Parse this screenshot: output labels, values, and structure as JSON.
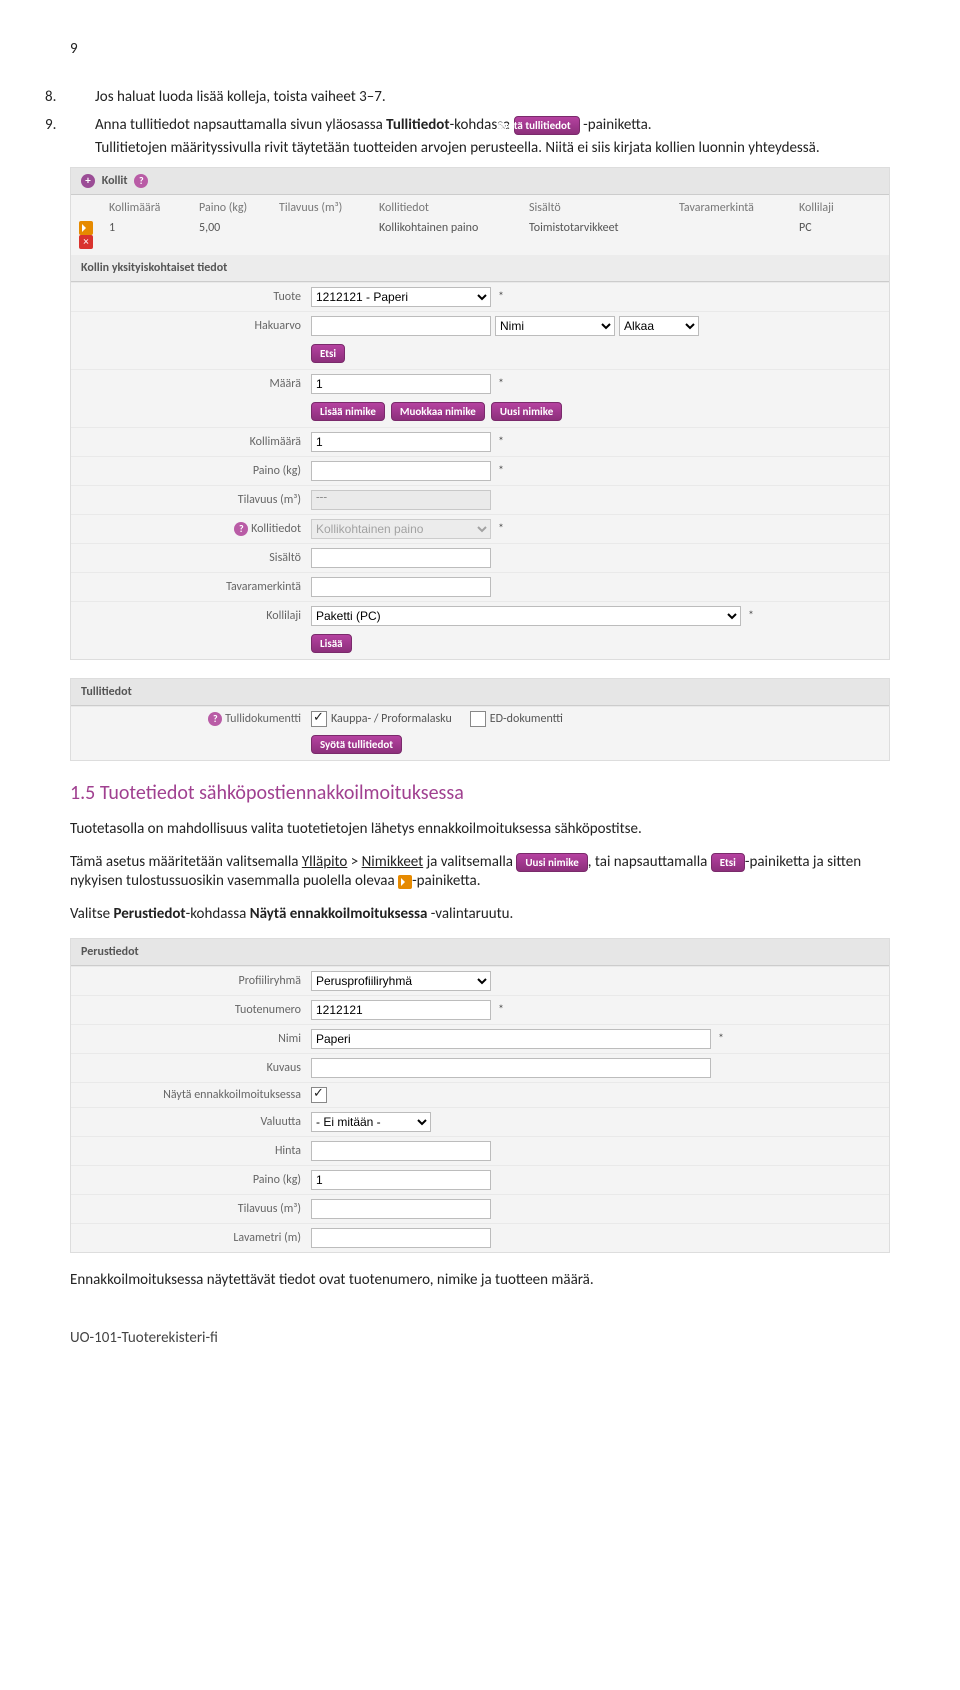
{
  "page_number": "9",
  "list8": {
    "num": "8.",
    "text": "Jos haluat luoda lisää kolleja, toista vaiheet 3–7."
  },
  "list9": {
    "num": "9.",
    "t1": "Anna tullitiedot napsauttamalla sivun yläosassa ",
    "t2": "Tullitiedot",
    "t3": "-kohdassa ",
    "btn": "Syötä tullitiedot",
    "t4": " -painiketta.",
    "t5": "Tullitietojen määrityssivulla rivit täytetään tuotteiden arvojen perusteella. Niitä ei siis kirjata kollien luonnin yhteydessä."
  },
  "kollit_section": {
    "title": "Kollit",
    "headers": [
      "Kollimäärä",
      "Paino (kg)",
      "Tilavuus (m³)",
      "Kollitiedot",
      "Sisältö",
      "Tavaramerkintä",
      "Kollilaji"
    ],
    "row": [
      "1",
      "5,00",
      "",
      "Kollikohtainen paino",
      "Toimistotarvikkeet",
      "",
      "PC"
    ],
    "subheader": "Kollin yksityiskohtaiset tiedot",
    "labels": {
      "tuote": "Tuote",
      "hakuarvo": "Hakuarvo",
      "maara": "Määrä",
      "kollimaara": "Kollimäärä",
      "paino": "Paino (kg)",
      "tilavuus": "Tilavuus (m³)",
      "kollitiedot": "Kollitiedot",
      "sisalto": "Sisältö",
      "tavaramerkinta": "Tavaramerkintä",
      "kollilaji": "Kollilaji"
    },
    "values": {
      "tuote": "1212121 - Paperi",
      "maara": "1",
      "kollimaara": "1",
      "tilavuus": "---",
      "kollitiedot": "Kollikohtainen paino",
      "kollilaji": "Paketti (PC)"
    },
    "hakuarvo_opts": {
      "nimi": "Nimi",
      "alkaa": "Alkaa"
    },
    "buttons": {
      "etsi": "Etsi",
      "lisaa_nimike": "Lisää nimike",
      "muokkaa_nimike": "Muokkaa nimike",
      "uusi_nimike": "Uusi nimike",
      "lisaa": "Lisää"
    }
  },
  "tullitiedot_section": {
    "title": "Tullitiedot",
    "label": "Tullidokumentti",
    "opt1": "Kauppa- / Proformalasku",
    "opt2": "ED-dokumentti",
    "btn": "Syötä tullitiedot"
  },
  "heading_1_5": "1.5  Tuotetiedot sähköpostiennakkoilmoituksessa",
  "para1": "Tuotetasolla on mahdollisuus valita tuotetietojen lähetys ennakkoilmoituksessa sähköpostitse.",
  "para2": {
    "t1": "Tämä asetus määritetään valitsemalla ",
    "yllapito": "Ylläpito",
    "t2": " > ",
    "nimikkeet": "Nimikkeet",
    "t3": " ja valitsemalla ",
    "btn_uusi": "Uusi nimike",
    "t4": ", tai napsauttamalla ",
    "btn_etsi": "Etsi",
    "t5": "-painiketta ja sitten nykyisen tulostussuosikin vasemmalla puolella olevaa ",
    "t6": "-painiketta."
  },
  "para3": {
    "t1": "Valitse ",
    "t2": "Perustiedot",
    "t3": "-kohdassa ",
    "t4": "Näytä ennakkoilmoituksessa",
    "t5": " -valintaruutu."
  },
  "perustiedot_section": {
    "title": "Perustiedot",
    "labels": {
      "profiiliryhma": "Profiiliryhmä",
      "tuotenumero": "Tuotenumero",
      "nimi": "Nimi",
      "kuvaus": "Kuvaus",
      "nayta": "Näytä ennakkoilmoituksessa",
      "valuutta": "Valuutta",
      "hinta": "Hinta",
      "paino": "Paino (kg)",
      "tilavuus": "Tilavuus (m³)",
      "lavametri": "Lavametri (m)"
    },
    "values": {
      "profiiliryhma": "Perusprofiiliryhmä",
      "tuotenumero": "1212121",
      "nimi": "Paperi",
      "valuutta": "- Ei mitään -",
      "paino": "1"
    }
  },
  "closing": "Ennakkoilmoituksessa näytettävät tiedot ovat tuotenumero, nimike ja tuotteen määrä.",
  "footer": "UO-101-Tuoterekisteri-fi"
}
